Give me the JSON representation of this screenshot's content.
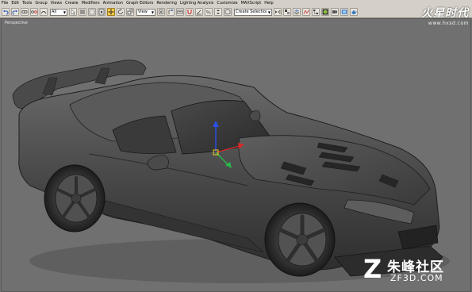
{
  "menubar": {
    "items": [
      "File",
      "Edit",
      "Tools",
      "Group",
      "Views",
      "Create",
      "Modifiers",
      "Animation",
      "Graph Editors",
      "Rendering",
      "Lighting Analysis",
      "Customize",
      "MAXScript",
      "Help"
    ]
  },
  "toolbar": {
    "filter_select": "All",
    "view_select": "View",
    "selection_set_select": "Create Selection Set",
    "highlighted_tool": "select-and-move"
  },
  "viewport": {
    "label": "Perspective"
  },
  "logo_top": {
    "mark": "火星时代",
    "url": "www.hxsd.com"
  },
  "watermark": {
    "cn": "朱峰社区",
    "en": "ZF3D.COM"
  },
  "colors": {
    "ui_grey": "#d4d0c8",
    "viewport_bg": "#707070",
    "gizmo_x": "#d42a2a",
    "gizmo_y": "#2ab84a",
    "gizmo_z": "#2a50e6",
    "gizmo_pivot": "#f3d12a"
  }
}
